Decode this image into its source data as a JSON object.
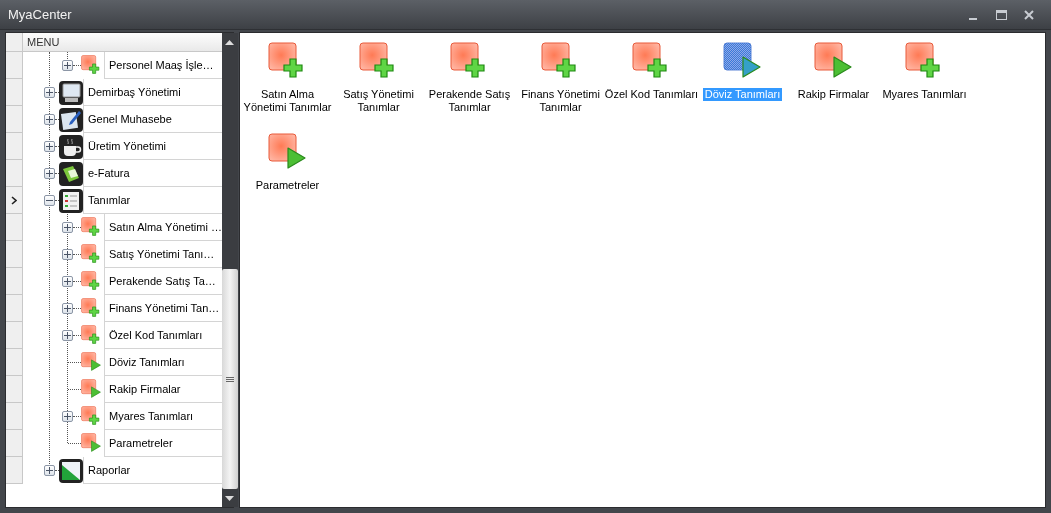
{
  "window": {
    "title": "MyaCenter"
  },
  "tree": {
    "header": "MENU",
    "continued_children": [
      {
        "label": "Personel Maaş İşle…",
        "kind": "add",
        "expanded": false,
        "current": false
      }
    ],
    "items": [
      {
        "label": "Demirbaş Yönetimi",
        "kind": "monitor",
        "expanded": false,
        "current": false
      },
      {
        "label": "Genel Muhasebe",
        "kind": "ledger",
        "expanded": false,
        "current": false
      },
      {
        "label": "Üretim Yönetimi",
        "kind": "cup",
        "expanded": false,
        "current": false
      },
      {
        "label": "e-Fatura",
        "kind": "invoice",
        "expanded": false,
        "current": false
      },
      {
        "label": "Tanımlar",
        "kind": "checklist",
        "expanded": true,
        "current": true,
        "children": [
          {
            "label": "Satın Alma Yönetimi …",
            "kind": "add",
            "expanded": false,
            "current": false
          },
          {
            "label": "Satış Yönetimi Tanı…",
            "kind": "add",
            "expanded": false,
            "current": false
          },
          {
            "label": "Perakende Satış Ta…",
            "kind": "add",
            "expanded": false,
            "current": false
          },
          {
            "label": "Finans Yönetimi Tan…",
            "kind": "add",
            "expanded": false,
            "current": false
          },
          {
            "label": "Özel Kod Tanımları",
            "kind": "add",
            "expanded": false,
            "current": false
          },
          {
            "label": "Döviz Tanımları",
            "kind": "run",
            "current": false
          },
          {
            "label": "Rakip Firmalar",
            "kind": "run",
            "current": false
          },
          {
            "label": "Myares Tanımları",
            "kind": "add",
            "expanded": false,
            "current": false
          },
          {
            "label": "Parametreler",
            "kind": "run",
            "current": false
          }
        ]
      },
      {
        "label": "Raporlar",
        "kind": "chart",
        "expanded": false,
        "current": false
      }
    ]
  },
  "tiles": [
    {
      "label": "Satın Alma Yönetimi Tanımlar",
      "kind": "add",
      "selected": false
    },
    {
      "label": "Satış Yönetimi Tanımlar",
      "kind": "add",
      "selected": false
    },
    {
      "label": "Perakende Satış Tanımlar",
      "kind": "add",
      "selected": false
    },
    {
      "label": "Finans Yönetimi Tanımlar",
      "kind": "add",
      "selected": false
    },
    {
      "label": "Özel Kod Tanımları",
      "kind": "add",
      "selected": false
    },
    {
      "label": "Döviz Tanımları",
      "kind": "run",
      "selected": true
    },
    {
      "label": "Rakip Firmalar",
      "kind": "run",
      "selected": false
    },
    {
      "label": "Myares Tanımları",
      "kind": "add",
      "selected": false
    },
    {
      "label": "Parametreler",
      "kind": "run",
      "selected": false
    }
  ]
}
